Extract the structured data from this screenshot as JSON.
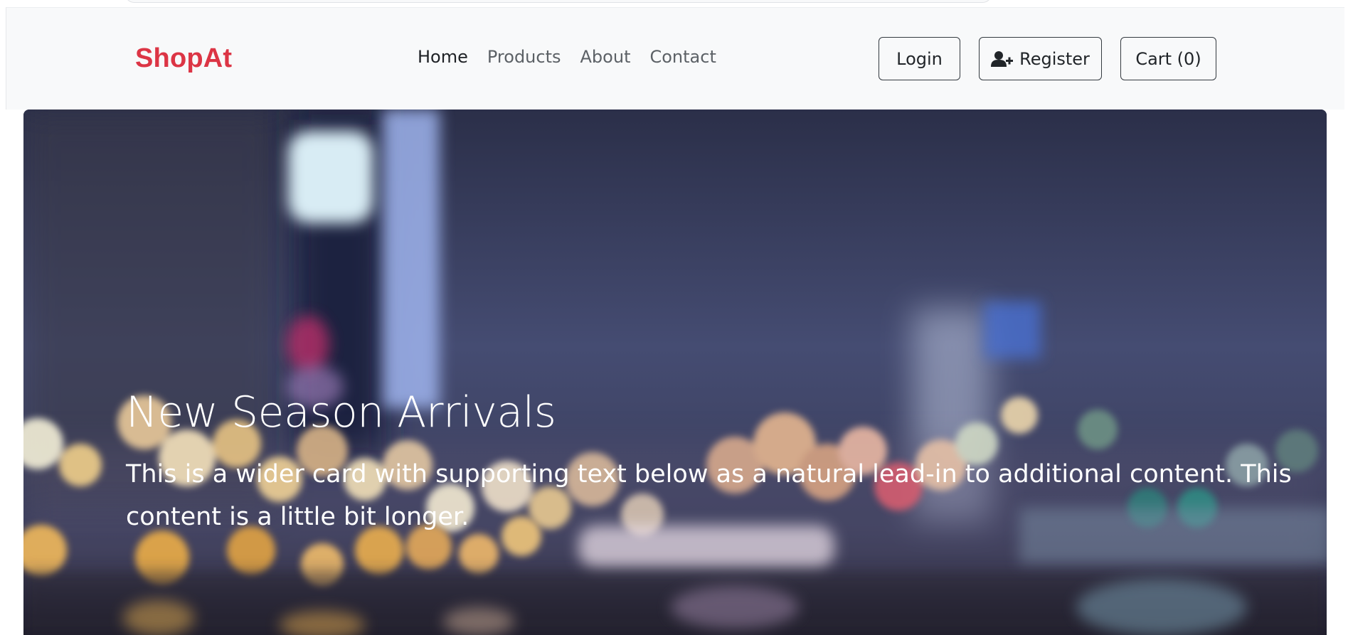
{
  "brand": {
    "name": "ShopAt",
    "color": "#dc3545"
  },
  "nav": {
    "links": [
      {
        "label": "Home",
        "active": true
      },
      {
        "label": "Products",
        "active": false
      },
      {
        "label": "About",
        "active": false
      },
      {
        "label": "Contact",
        "active": false
      }
    ]
  },
  "actions": {
    "login_label": "Login",
    "register_label": "Register",
    "register_icon": "user-plus-icon",
    "cart_label": "Cart (0)"
  },
  "hero": {
    "title": "New Season Arrivals",
    "description": "This is a wider card with supporting text below as a natural lead-in to additional content. This content is a little bit longer.",
    "background": "blurred-city-night-bokeh-image"
  }
}
